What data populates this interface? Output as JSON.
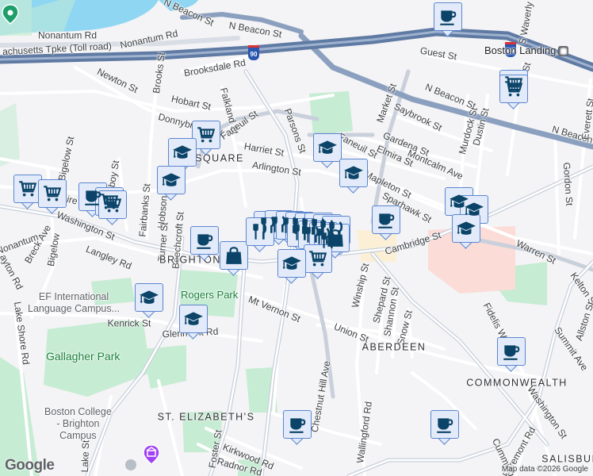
{
  "map": {
    "attribution": "Map data ©2026 Google",
    "logo": "Google",
    "highway_shields": [
      "90",
      "90"
    ],
    "transit_station": "Boston Landing",
    "colors": {
      "water": "#8fd6f3",
      "park": "#c6ecd3",
      "hospital": "#fbdcd7",
      "highway": "#8ba0bf",
      "road": "#ffffff",
      "marker_fill": "#e3ebfa",
      "marker_border": "#5b86cf",
      "icon": "#0b4468"
    },
    "labels": [
      "N Beacon St",
      "N Beacon St",
      "Nonantum Rd",
      "Nonantum Rd",
      "achusetts Tpke (Toll road)",
      "Newton St",
      "Brooksdale Rd",
      "Brooks St",
      "Hobart St",
      "Falkland St",
      "Donnybrook Rd",
      "Faneuil St",
      "Bigelow St",
      "Perthshire Rd",
      "Dunboy St",
      "Hobson St",
      "Fairbanks St",
      "Turner St",
      "Beechcroft St",
      "Bigelow",
      "SQUARE",
      "Harriet St",
      "Arlington St",
      "Parsons St",
      "Faneuil St",
      "Market St",
      "Saybrook St",
      "N Beacon St",
      "N Beacon St",
      "Gardena St",
      "Elmira St",
      "Montcalm Ave",
      "Mapleton St",
      "Murdock St",
      "Dustin St",
      "Arthur St",
      "Guest St",
      "S Waverly St",
      "Everett St",
      "Gordon St",
      "Sparhawk St",
      "Cambridge St",
      "Warren St",
      "Kelton St",
      "Washington St",
      "Langley Rd",
      "Nonantum",
      "Breck Ave",
      "ayton Rd",
      "BRIGHTON",
      "Mt Vernon St",
      "Winship St",
      "Shepard St",
      "Shannon St",
      "Snow St",
      "Union St",
      "Kenrick St",
      "Glenmont Rd",
      "Lake Shore Rd",
      "Chestnut Hill Ave",
      "ABERDEEN",
      "COMMONWEALTH",
      "Fidelis Way",
      "Summit Ave",
      "Allston St",
      "ST. ELIZABETH'S",
      "Wallingford Rd",
      "Washington St",
      "Egremont Rd",
      "Cummings Rd",
      "SALISBURY",
      "Foster St",
      "Kirkwood Rd",
      "Radnor Rd",
      "Lake St",
      "Mapleton St",
      "Faneuil St"
    ],
    "parks": [
      "Rogers Park",
      "Gallagher Park"
    ],
    "pois": [
      "EF International\nLanguage Campus...",
      "Boston College\n- Brighton\nCampus"
    ],
    "markers": [
      "coffee",
      "cart",
      "cart",
      "cart",
      "graduation-cap",
      "graduation-cap",
      "graduation-cap",
      "graduation-cap",
      "cart",
      "cart",
      "coffee",
      "cart",
      "cart",
      "coffee",
      "graduation-cap",
      "graduation-cap",
      "graduation-cap",
      "coffee",
      "bag",
      "restaurant",
      "restaurant",
      "restaurant",
      "restaurant",
      "restaurant",
      "restaurant",
      "restaurant",
      "restaurant",
      "restaurant",
      "restaurant",
      "restaurant",
      "restaurant",
      "restaurant",
      "bag",
      "cart",
      "graduation-cap",
      "graduation-cap",
      "graduation-cap",
      "coffee",
      "coffee",
      "coffee"
    ]
  }
}
